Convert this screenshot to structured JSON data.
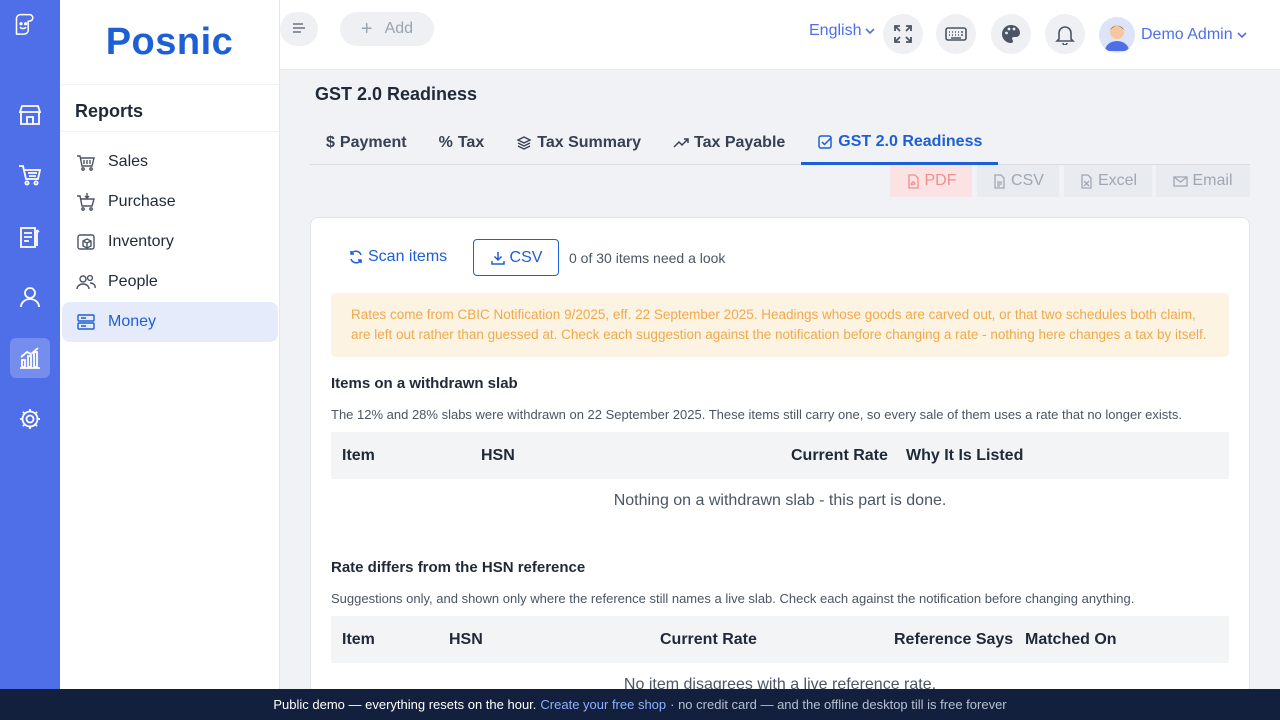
{
  "brand": {
    "name": "Posnic"
  },
  "rail": {
    "items": [
      "store-icon",
      "cart-icon",
      "clipboard-icon",
      "user-icon",
      "chart-icon",
      "settings-icon"
    ],
    "active_index": 4
  },
  "panel": {
    "title": "Reports",
    "items": [
      {
        "label": "Sales",
        "icon": "basket-icon"
      },
      {
        "label": "Purchase",
        "icon": "cart-icon"
      },
      {
        "label": "Inventory",
        "icon": "box-icon"
      },
      {
        "label": "People",
        "icon": "people-icon"
      },
      {
        "label": "Money",
        "icon": "money-icon",
        "active": true
      }
    ]
  },
  "topbar": {
    "add_label": "Add",
    "language": "English",
    "user_name": "Demo Admin"
  },
  "page": {
    "title": "GST 2.0 Readiness"
  },
  "tabs": [
    {
      "label": "Payment",
      "icon": "dollar-icon"
    },
    {
      "label": "Tax",
      "icon": "percent-icon"
    },
    {
      "label": "Tax Summary",
      "icon": "layers-icon"
    },
    {
      "label": "Tax Payable",
      "icon": "trend-icon"
    },
    {
      "label": "GST 2.0 Readiness",
      "icon": "check-square-icon",
      "active": true
    }
  ],
  "exports": {
    "pdf": "PDF",
    "csv": "CSV",
    "excel": "Excel",
    "email": "Email"
  },
  "card": {
    "scan_label": "Scan items",
    "csv_label": "CSV",
    "status": "0 of 30 items need a look",
    "notice": "Rates come from CBIC Notification 9/2025, eff. 22 September 2025. Headings whose goods are carved out, or that two schedules both claim, are left out rather than guessed at. Check each suggestion against the notification before changing a rate - nothing here changes a tax by itself.",
    "withdrawn": {
      "title": "Items on a withdrawn slab",
      "desc": "The 12% and 28% slabs were withdrawn on 22 September 2025. These items still carry one, so every sale of them uses a rate that no longer exists.",
      "columns": [
        "Item",
        "HSN",
        "Current Rate",
        "Why It Is Listed"
      ],
      "empty": "Nothing on a withdrawn slab - this part is done."
    },
    "differs": {
      "title": "Rate differs from the HSN reference",
      "desc": "Suggestions only, and shown only where the reference still names a live slab. Check each against the notification before changing anything.",
      "columns": [
        "Item",
        "HSN",
        "Current Rate",
        "Reference Says",
        "Matched On"
      ],
      "empty": "No item disagrees with a live reference rate."
    }
  },
  "banner": {
    "text": "Public demo — everything resets on the hour.",
    "link": "Create your free shop",
    "rest": "· no credit card — and the offline desktop till is free forever"
  },
  "colors": {
    "accent": "#1d5fd6",
    "rail": "#4f6fe8",
    "notice_bg": "#fdf3e2",
    "notice_text": "#f0a94a",
    "banner": "#12203d"
  }
}
